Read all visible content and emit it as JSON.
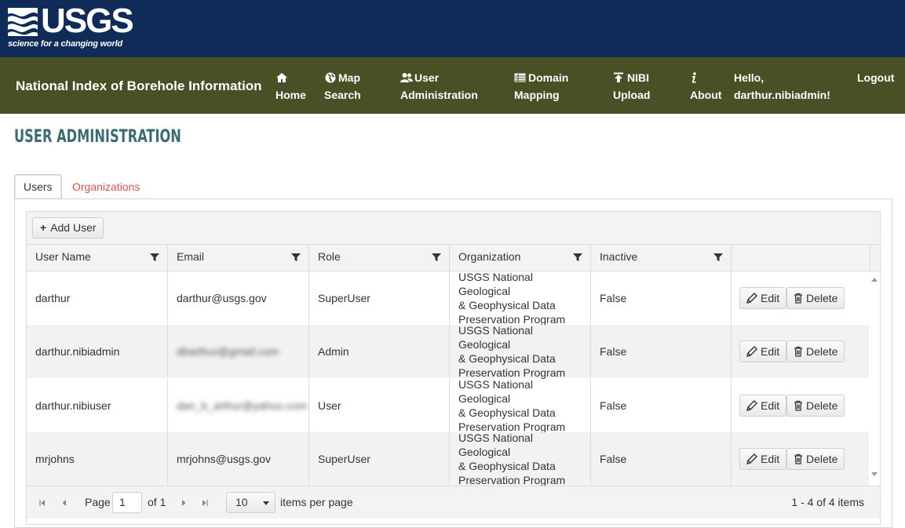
{
  "header": {
    "logo_text": "USGS",
    "logo_tagline": "science for a changing world",
    "colors": {
      "usgs_band": "#0f2b58",
      "nav_bar": "#4a5026",
      "title": "#3b6b74",
      "inactive_tab": "#d9534f"
    }
  },
  "nav": {
    "brand": "National Index of Borehole Information",
    "items": [
      {
        "icon": "home-icon",
        "line1": "",
        "line2": "Home"
      },
      {
        "icon": "globe-icon",
        "line1": "Map",
        "line2": "Search"
      },
      {
        "icon": "users-icon",
        "line1": "User",
        "line2": "Administration"
      },
      {
        "icon": "table-icon",
        "line1": "Domain",
        "line2": "Mapping"
      },
      {
        "icon": "upload-icon",
        "line1": "NIBI",
        "line2": "Upload"
      },
      {
        "icon": "info-icon",
        "line1": "",
        "line2": "About"
      }
    ],
    "greeting_line1": "Hello,",
    "greeting_line2": "darthur.nibiadmin!",
    "logout": "Logout"
  },
  "page": {
    "title": "USER ADMINISTRATION",
    "tabs": [
      "Users",
      "Organizations"
    ],
    "active_tab": "Users"
  },
  "grid": {
    "add_button": "Add User",
    "columns": [
      "User Name",
      "Email",
      "Role",
      "Organization",
      "Inactive"
    ],
    "rows": [
      {
        "username": "darthur",
        "email": "darthur@usgs.gov",
        "role": "SuperUser",
        "org1": "USGS National Geological",
        "org2": "& Geophysical Data",
        "org3": "Preservation Program",
        "inactive": "False"
      },
      {
        "username": "darthur.nibiadmin",
        "email": "dbarthur@gmail.com",
        "role": "Admin",
        "org1": "USGS National Geological",
        "org2": "& Geophysical Data",
        "org3": "Preservation Program",
        "inactive": "False"
      },
      {
        "username": "darthur.nibiuser",
        "email": "dan_b_arthur@yahoo.com",
        "role": "User",
        "org1": "USGS National Geological",
        "org2": "& Geophysical Data",
        "org3": "Preservation Program",
        "inactive": "False"
      },
      {
        "username": "mrjohns",
        "email": "mrjohns@usgs.gov",
        "role": "SuperUser",
        "org1": "USGS National Geological",
        "org2": "& Geophysical Data",
        "org3": "Preservation Program",
        "inactive": "False"
      }
    ],
    "edit_label": "Edit",
    "delete_label": "Delete",
    "pager": {
      "page_label": "Page",
      "page_value": "1",
      "of_label": "of 1",
      "page_size": "10",
      "items_per_page": "items per page",
      "summary": "1 - 4 of 4 items"
    }
  }
}
